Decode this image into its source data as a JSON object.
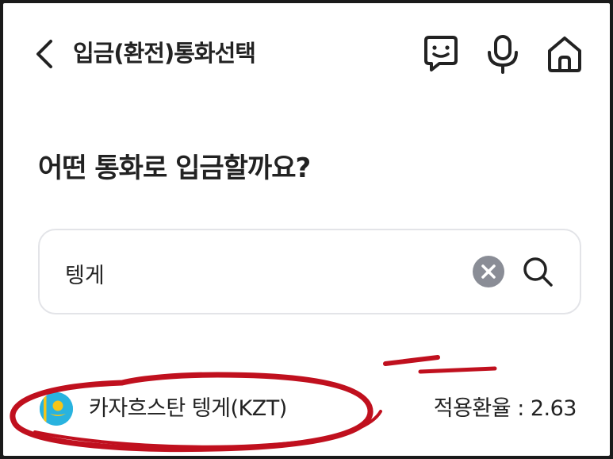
{
  "header": {
    "title": "입금(환전)통화선택",
    "icons": [
      "back-icon",
      "chatbot-icon",
      "microphone-icon",
      "home-icon"
    ]
  },
  "main": {
    "question": "어떤 통화로 입금할까요?",
    "search": {
      "value": "텡게",
      "placeholder": ""
    },
    "results": [
      {
        "flag": "kazakhstan-flag-icon",
        "name": "카자흐스탄 텡게(KZT)",
        "rate_text": "적용환율 : 2.63"
      }
    ]
  },
  "colors": {
    "text": "#222222",
    "clear_button": "#8a8d96",
    "search_border": "#e3e4e8",
    "flag_blue": "#29b3df",
    "flag_gold": "#f5c518",
    "annotation_red": "#c0101e"
  }
}
